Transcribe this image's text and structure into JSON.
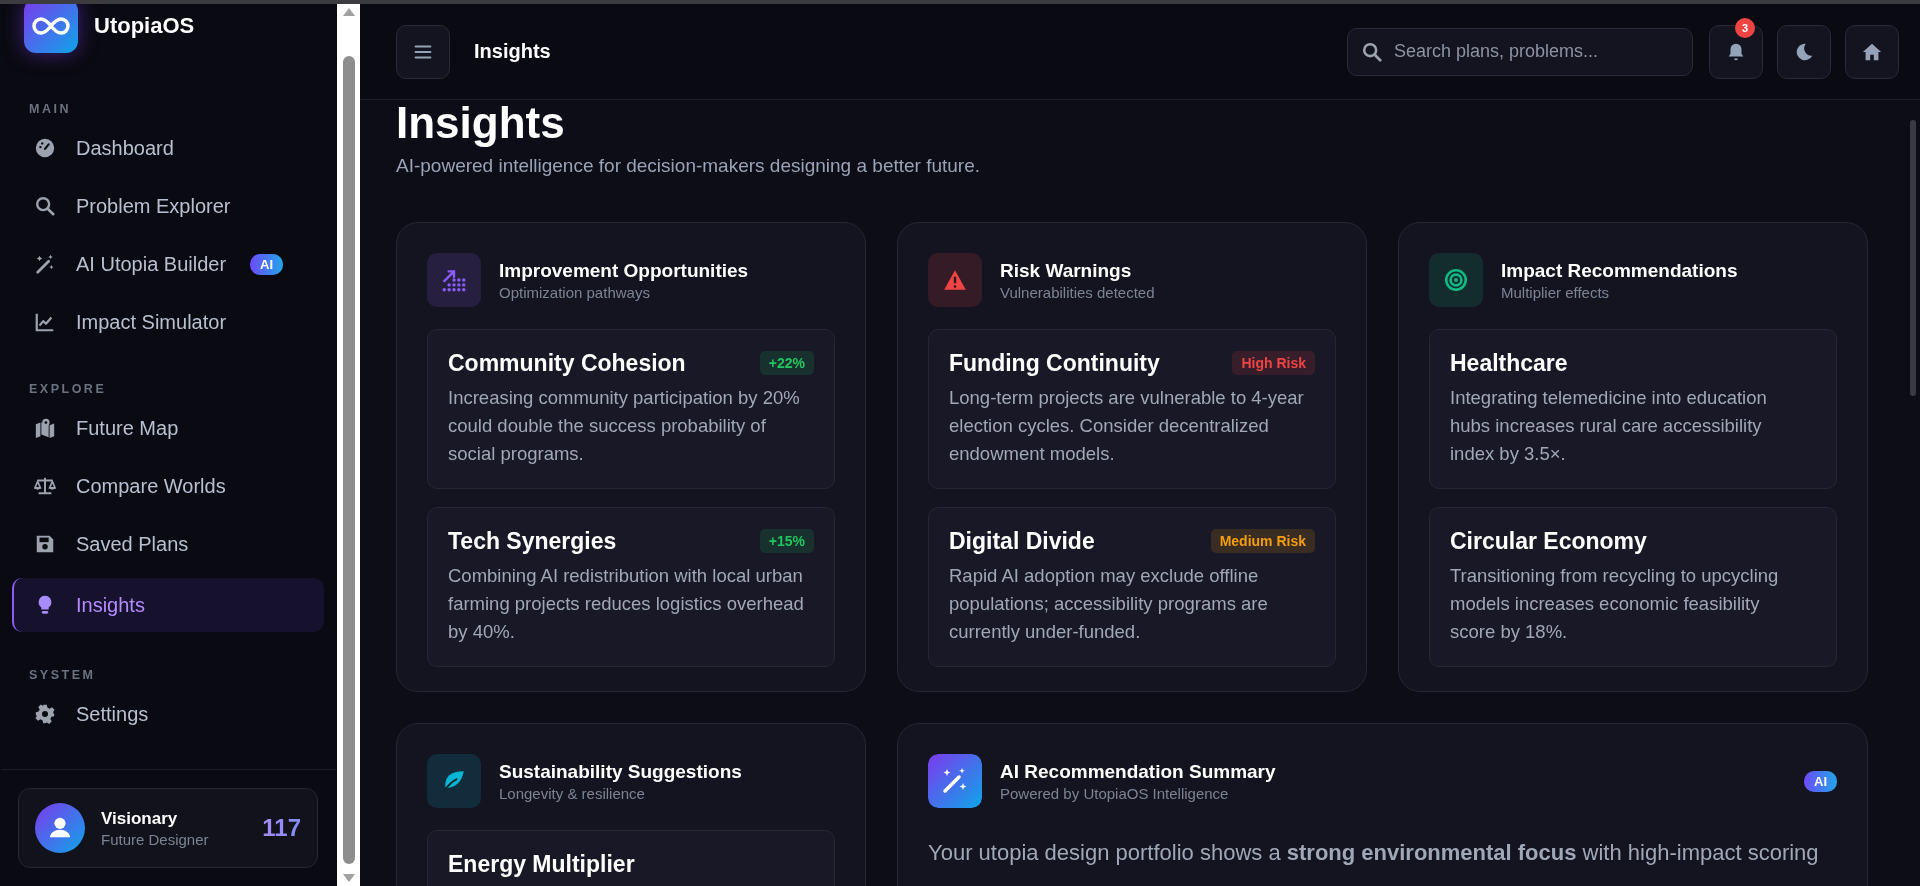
{
  "sidebar": {
    "brand": "UtopiaOS",
    "sections": [
      {
        "label": "MAIN",
        "items": [
          {
            "label": "Dashboard",
            "selected": false
          },
          {
            "label": "Problem Explorer",
            "selected": false
          },
          {
            "label": "AI Utopia Builder",
            "badge": "AI",
            "selected": false
          },
          {
            "label": "Impact Simulator",
            "selected": false
          }
        ]
      },
      {
        "label": "EXPLORE",
        "items": [
          {
            "label": "Future Map",
            "selected": false
          },
          {
            "label": "Compare Worlds",
            "selected": false
          },
          {
            "label": "Saved Plans",
            "selected": false
          },
          {
            "label": "Insights",
            "selected": true
          }
        ]
      },
      {
        "label": "SYSTEM",
        "items": [
          {
            "label": "Settings",
            "selected": false
          }
        ]
      }
    ],
    "profile": {
      "name": "Visionary",
      "role": "Future Designer",
      "score": "117"
    }
  },
  "topbar": {
    "title": "Insights",
    "search": {
      "placeholder": "Search plans, problems..."
    },
    "notification_count": "3"
  },
  "page": {
    "title": "Insights",
    "subtitle": "AI-powered intelligence for decision-makers designing a better future."
  },
  "cards": [
    {
      "title": "Improvement Opportunities",
      "subtitle": "Optimization pathways",
      "color": "#8b5cf6",
      "items": [
        {
          "title": "Community Cohesion",
          "badge": {
            "label": "+22%",
            "kind": "positive"
          },
          "text": "Increasing community participation by 20% could double the success probability of social programs."
        },
        {
          "title": "Tech Synergies",
          "badge": {
            "label": "+15%",
            "kind": "positive"
          },
          "text": "Combining AI redistribution with local urban farming projects reduces logistics overhead by 40%."
        }
      ]
    },
    {
      "title": "Risk Warnings",
      "subtitle": "Vulnerabilities detected",
      "color": "#ef4444",
      "items": [
        {
          "title": "Funding Continuity",
          "badge": {
            "label": "High Risk",
            "kind": "high"
          },
          "text": "Long-term projects are vulnerable to 4-year election cycles. Consider decentralized endowment models."
        },
        {
          "title": "Digital Divide",
          "badge": {
            "label": "Medium Risk",
            "kind": "medium"
          },
          "text": "Rapid AI adoption may exclude offline populations; accessibility programs are currently under-funded."
        }
      ]
    },
    {
      "title": "Impact Recommendations",
      "subtitle": "Multiplier effects",
      "color": "#10b981",
      "items": [
        {
          "title": "Healthcare",
          "text": "Integrating telemedicine into education hubs increases rural care accessibility index by 3.5×."
        },
        {
          "title": "Circular Economy",
          "text": "Transitioning from recycling to upcycling models increases economic feasibility score by 18%."
        }
      ]
    },
    {
      "title": "Sustainability Suggestions",
      "subtitle": "Longevity & resilience",
      "color": "#06b6d4",
      "items": [
        {
          "title": "Energy Multiplier"
        }
      ]
    }
  ],
  "summary": {
    "title": "AI Recommendation Summary",
    "subtitle": "Powered by UtopiaOS Intelligence",
    "badge": "AI",
    "text": "Your utopia design portfolio shows a **strong environmental focus** with high-impact scoring"
  }
}
